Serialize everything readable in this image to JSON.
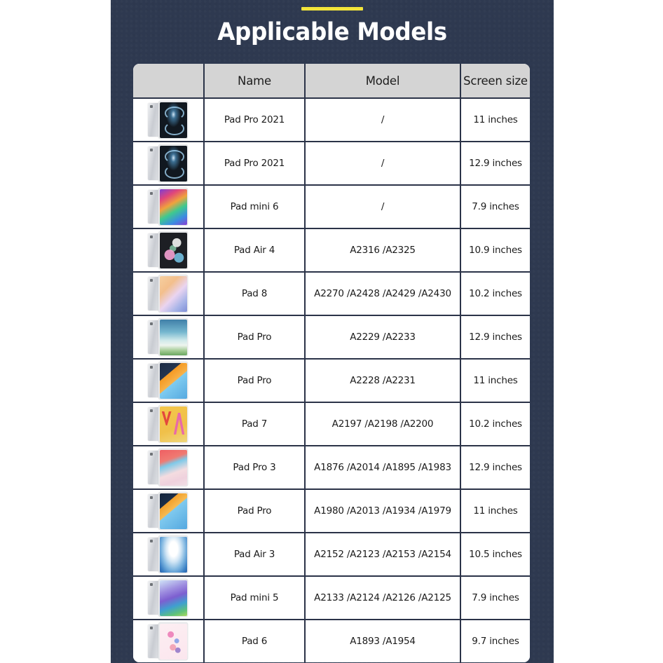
{
  "title": "Applicable Models",
  "accent_color": "#f2e43a",
  "panel_color": "#2e3950",
  "table": {
    "headers": {
      "thumbnail": "",
      "name": "Name",
      "model": "Model",
      "screen_size": "Screen size"
    },
    "rows": [
      {
        "thumb": "scr-prolidar",
        "name": "Pad Pro 2021",
        "model": "/",
        "size": "11 inches"
      },
      {
        "thumb": "scr-prolidar",
        "name": "Pad Pro 2021",
        "model": "/",
        "size": "12.9 inches"
      },
      {
        "thumb": "scr-mini6",
        "name": "Pad mini 6",
        "model": "/",
        "size": "7.9 inches"
      },
      {
        "thumb": "scr-air4",
        "name": "Pad Air 4",
        "model": "A2316 /A2325",
        "size": "10.9 inches"
      },
      {
        "thumb": "scr-pad8",
        "name": "Pad 8",
        "model": "A2270 /A2428 /A2429 /A2430",
        "size": "10.2 inches"
      },
      {
        "thumb": "scr-padpro129",
        "name": "Pad Pro",
        "model": "A2229 /A2233",
        "size": "12.9 inches"
      },
      {
        "thumb": "scr-padpro11",
        "name": "Pad Pro",
        "model": "A2228 /A2231",
        "size": "11 inches"
      },
      {
        "thumb": "scr-pad7",
        "name": "Pad 7",
        "model": "A2197 /A2198 /A2200",
        "size": "10.2 inches"
      },
      {
        "thumb": "scr-padpro3",
        "name": "Pad Pro 3",
        "model": "A1876 /A2014 /A1895 /A1983",
        "size": "12.9 inches"
      },
      {
        "thumb": "scr-padpro11b",
        "name": "Pad Pro",
        "model": "A1980 /A2013 /A1934 /A1979",
        "size": "11 inches"
      },
      {
        "thumb": "scr-air3",
        "name": "Pad Air 3",
        "model": "A2152 /A2123 /A2153 /A2154",
        "size": "10.5 inches"
      },
      {
        "thumb": "scr-mini5",
        "name": "Pad mini 5",
        "model": "A2133 /A2124 /A2126 /A2125",
        "size": "7.9 inches"
      },
      {
        "thumb": "scr-pad6",
        "name": "Pad 6",
        "model": "A1893 /A1954",
        "size": "9.7 inches"
      }
    ]
  }
}
